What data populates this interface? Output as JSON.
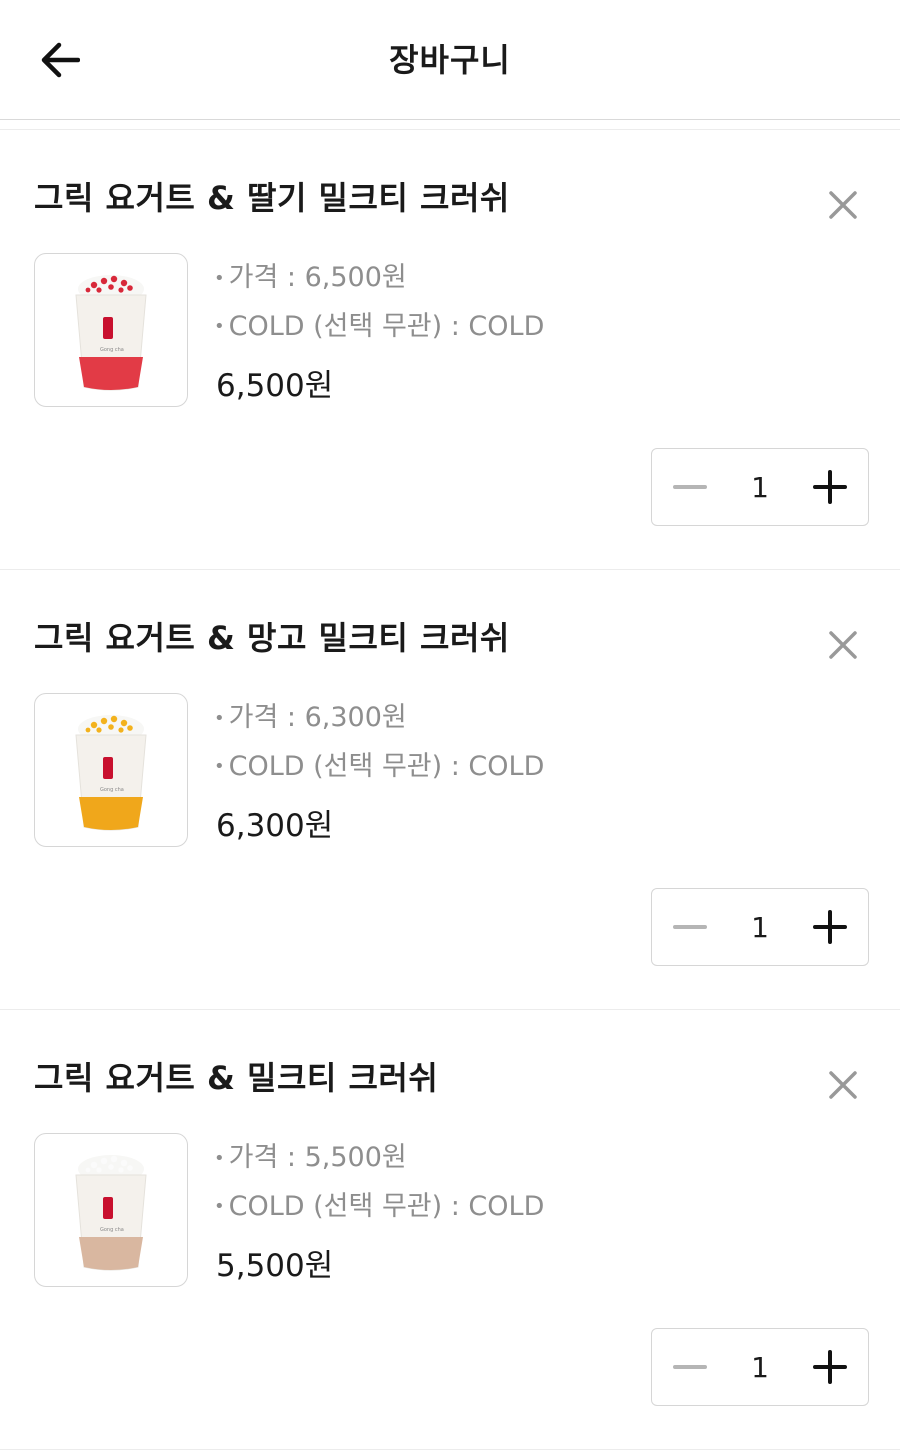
{
  "header": {
    "title": "장바구니",
    "back_icon": "arrow-left-icon"
  },
  "items": [
    {
      "name": "그릭 요거트 & 딸기 밀크티 크러쉬",
      "options": [
        {
          "label": "가격",
          "value": "6,500원"
        },
        {
          "label": "COLD (선택 무관)",
          "value": "COLD"
        }
      ],
      "price": "6,500원",
      "quantity": "1",
      "topping_color": "#d8293a",
      "base_color": "#e23b46"
    },
    {
      "name": "그릭 요거트 & 망고 밀크티 크러쉬",
      "options": [
        {
          "label": "가격",
          "value": "6,300원"
        },
        {
          "label": "COLD (선택 무관)",
          "value": "COLD"
        }
      ],
      "price": "6,300원",
      "quantity": "1",
      "topping_color": "#f3b21d",
      "base_color": "#f0a71b"
    },
    {
      "name": "그릭 요거트 & 밀크티 크러쉬",
      "options": [
        {
          "label": "가격",
          "value": "5,500원"
        },
        {
          "label": "COLD (선택 무관)",
          "value": "COLD"
        }
      ],
      "price": "5,500원",
      "quantity": "1",
      "topping_color": "#ffffff",
      "base_color": "#d9b7a0"
    }
  ],
  "separator": " : ",
  "bullet": "•"
}
